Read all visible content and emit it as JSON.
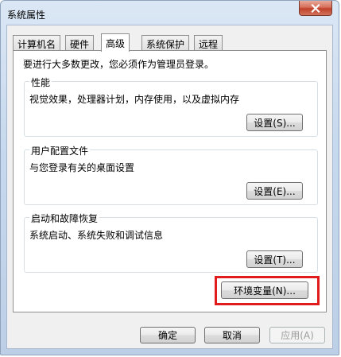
{
  "window": {
    "title": "系统属性"
  },
  "tabs": [
    {
      "label": "计算机名"
    },
    {
      "label": "硬件"
    },
    {
      "label": "高级"
    },
    {
      "label": "系统保护"
    },
    {
      "label": "远程"
    }
  ],
  "active_tab": "高级",
  "panel": {
    "intro": "要进行大多数更改，您必须作为管理员登录。",
    "performance": {
      "title": "性能",
      "desc": "视觉效果，处理器计划，内存使用，以及虚拟内存",
      "button": "设置(S)..."
    },
    "user_profiles": {
      "title": "用户配置文件",
      "desc": "与您登录有关的桌面设置",
      "button": "设置(E)..."
    },
    "startup_recovery": {
      "title": "启动和故障恢复",
      "desc": "系统启动、系统失败和调试信息",
      "button": "设置(T)..."
    },
    "env_button": "环境变量(N)..."
  },
  "footer": {
    "ok": "确定",
    "cancel": "取消",
    "apply": "应用(A)"
  },
  "colors": {
    "highlight": "#e21c1c",
    "close_button": "#c0412a"
  },
  "icons": {
    "close": "close-icon"
  }
}
